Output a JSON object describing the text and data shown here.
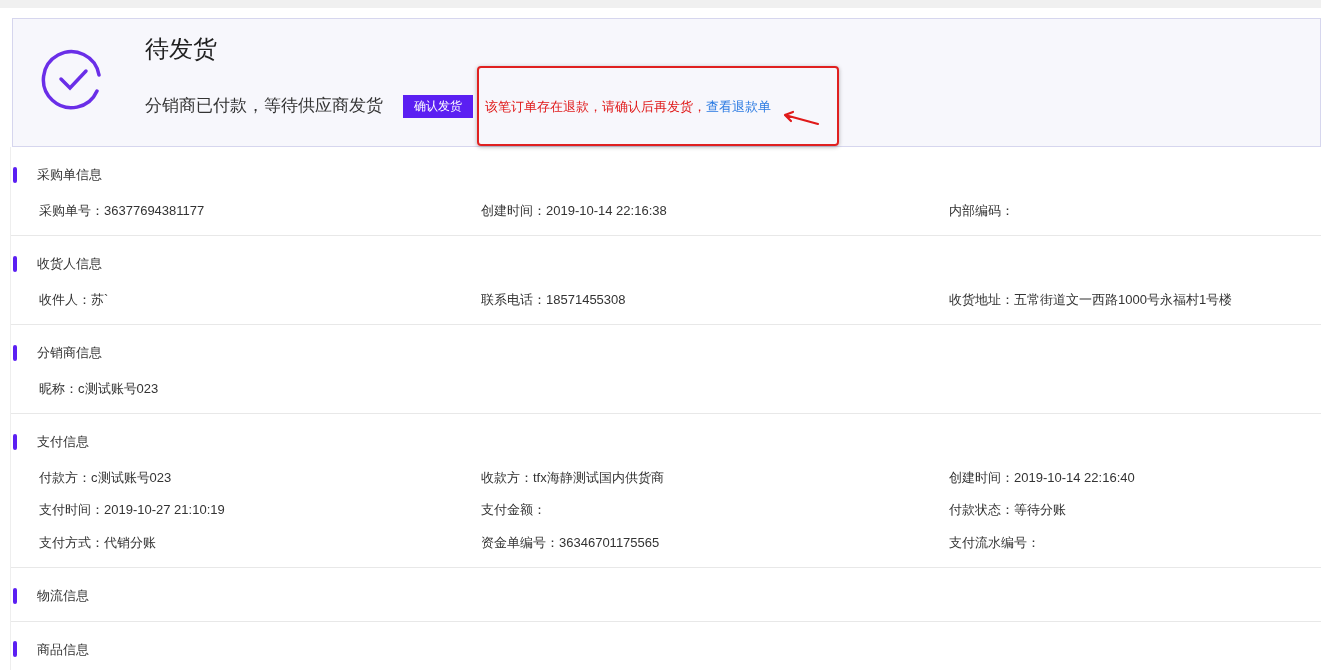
{
  "status": {
    "title": "待发货",
    "subtitle": "分销商已付款，等待供应商发货",
    "button": "确认发货",
    "warning": "该笔订单存在退款，请确认后再发货，",
    "link": "查看退款单"
  },
  "sections": [
    {
      "title": "采购单信息",
      "rows": [
        [
          "采购单号：36377694381177",
          "创建时间：2019-10-14 22:16:38",
          "内部编码："
        ]
      ]
    },
    {
      "title": "收货人信息",
      "rows": [
        [
          "收件人：苏`",
          "联系电话：18571455308",
          "收货地址：五常街道文一西路1000号永福村1号楼"
        ]
      ]
    },
    {
      "title": "分销商信息",
      "rows": [
        [
          "昵称：c测试账号023"
        ]
      ]
    },
    {
      "title": "支付信息",
      "rows": [
        [
          "付款方：c测试账号023",
          "收款方：tfx海静测试国内供货商",
          "创建时间：2019-10-14 22:16:40"
        ],
        [
          "支付时间：2019-10-27 21:10:19",
          "支付金额：",
          "付款状态：等待分账"
        ],
        [
          "支付方式：代销分账",
          "资金单编号：36346701175565",
          "支付流水编号："
        ]
      ]
    },
    {
      "title": "物流信息"
    },
    {
      "title": "商品信息"
    }
  ]
}
